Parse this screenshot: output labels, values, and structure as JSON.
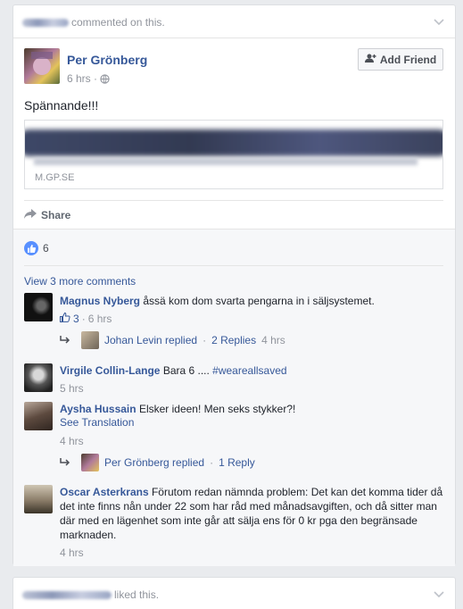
{
  "card1": {
    "header_text": "commented on this.",
    "author": "Per Grönberg",
    "time": "6 hrs",
    "add_friend": "Add Friend",
    "post_text": "Spännande!!!",
    "link_domain": "M.GP.SE",
    "share": "Share",
    "like_count": "6",
    "view_more": "View 3 more comments",
    "comments": [
      {
        "name": "Magnus Nyberg",
        "text": "åssä kom dom svarta pengarna in i säljsystemet.",
        "likes": "3",
        "time": "6 hrs",
        "reply": {
          "name": "Johan Levin replied",
          "sep": "·",
          "count": "2 Replies",
          "time": "4 hrs"
        }
      },
      {
        "name": "Virgile Collin-Lange",
        "text": "Bara 6 .... ",
        "hashtag": "#weareallsaved",
        "time": "5 hrs"
      },
      {
        "name": "Aysha Hussain",
        "text": "Elsker ideen! Men seks stykker?!",
        "see_translation": "See Translation",
        "time": "4 hrs",
        "reply": {
          "name": "Per Grönberg replied",
          "sep": "·",
          "count": "1 Reply"
        }
      },
      {
        "name": "Oscar Asterkrans",
        "text": "Förutom redan nämnda problem: Det kan det komma tider då det inte finns nån under 22 som har råd med månadsavgiften, och då sitter man där med en lägenhet som inte går att sälja ens för 0 kr pga den begränsade marknaden.",
        "time": "4 hrs"
      }
    ]
  },
  "card2": {
    "header_text": "liked this."
  },
  "colors": {
    "link": "#365899",
    "meta": "#90949c",
    "like_blue": "#5890ff",
    "bg": "#e9ebee"
  },
  "icons": [
    "chevron-down-icon",
    "add-friend-icon",
    "globe-icon",
    "share-icon",
    "like-icon",
    "reply-arrow-icon"
  ]
}
